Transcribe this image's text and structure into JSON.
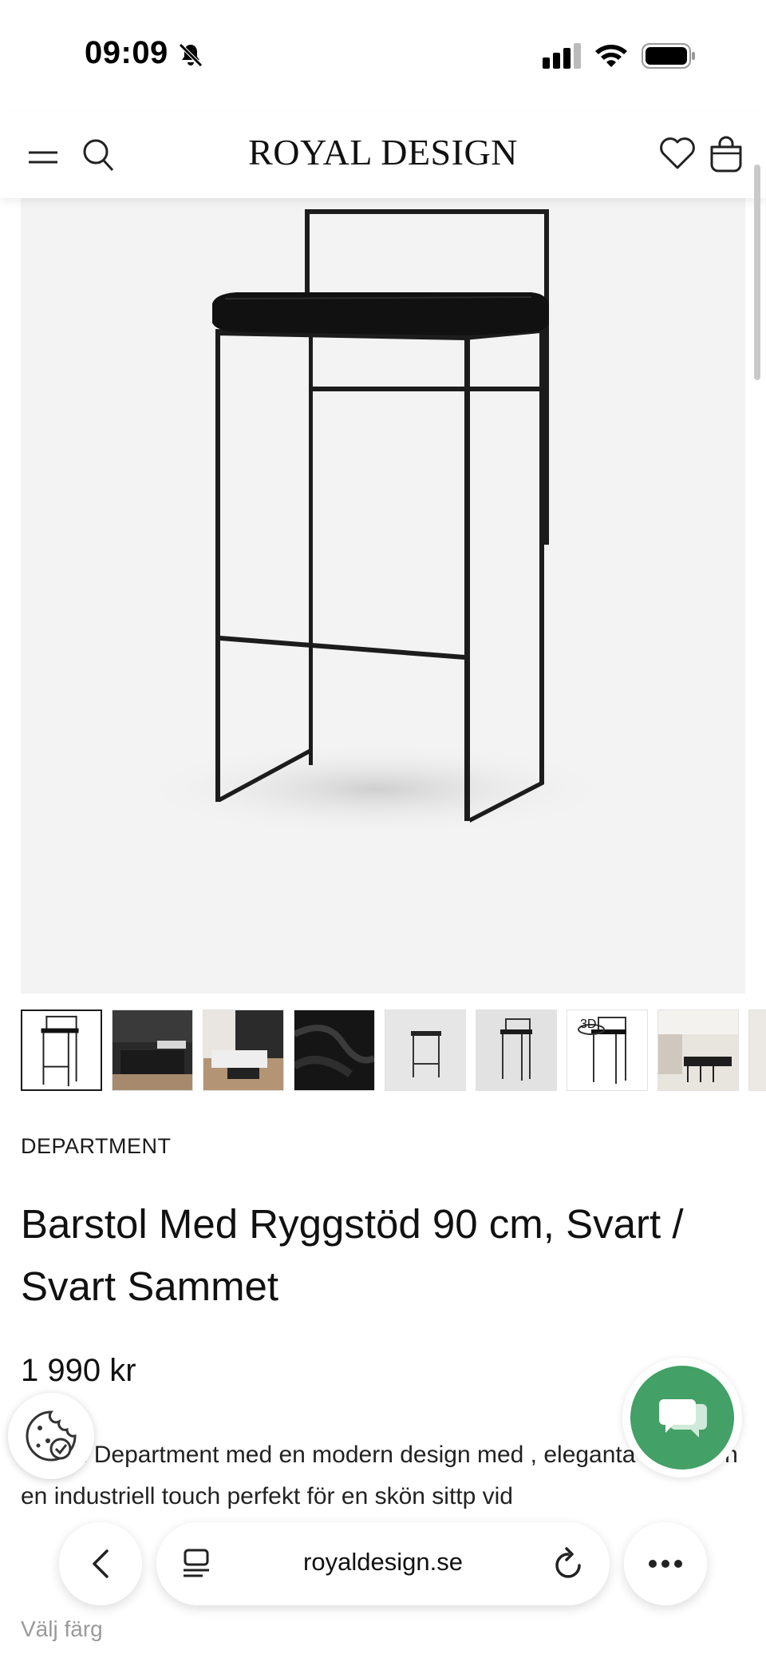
{
  "status_bar": {
    "time": "09:09",
    "icons": [
      "bell-slash-icon",
      "cellular-signal-icon",
      "wifi-icon",
      "battery-icon"
    ]
  },
  "header": {
    "logo": "ROYAL DESIGN",
    "icons": [
      "menu-icon",
      "search-icon",
      "heart-icon",
      "shopping-bag-icon"
    ]
  },
  "gallery": {
    "main_image": "black bar stool with backrest and black velvet seat",
    "thumbnails": [
      {
        "kind": "stool-front",
        "selected": true
      },
      {
        "kind": "dark-kitchen"
      },
      {
        "kind": "kitchen-island"
      },
      {
        "kind": "velvet-fabric"
      },
      {
        "kind": "stool-low"
      },
      {
        "kind": "stool-side"
      },
      {
        "kind": "stool-3d",
        "badge": "3D"
      },
      {
        "kind": "kitchen-interior"
      },
      {
        "kind": "partial"
      }
    ]
  },
  "product": {
    "brand": "DEPARTMENT",
    "title": "Barstol Med Ryggstöd 90 cm, Svart / Svart Sammet",
    "price": "1 990 kr",
    "description": "ol från Department med en modern design med , eleganta linjer och en industriell touch perfekt för en skön sittp vid",
    "color_label": "Välj färg"
  },
  "browser": {
    "url": "royaldesign.se"
  },
  "colors": {
    "chat_green": "#43a066",
    "text": "#111111",
    "muted": "#9a9a9a"
  }
}
